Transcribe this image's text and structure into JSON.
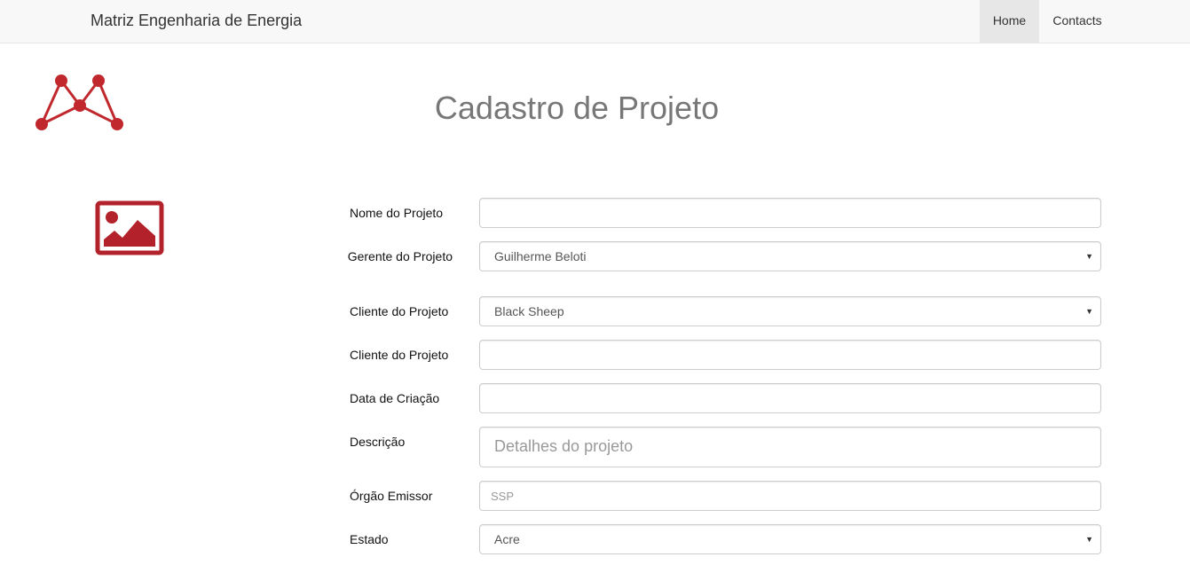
{
  "navbar": {
    "brand": "Matriz Engenharia de Energia",
    "items": [
      {
        "label": "Home",
        "active": true
      },
      {
        "label": "Contacts",
        "active": false
      }
    ]
  },
  "colors": {
    "brand_red": "#c0282d",
    "navbar_bg": "#f8f8f8",
    "active_nav_bg": "#e7e7e7"
  },
  "page": {
    "title": "Cadastro de Projeto"
  },
  "icons": {
    "logo": "matriz-logo-icon",
    "photo": "image-placeholder-icon",
    "caret": "caret-down-icon"
  },
  "form": {
    "nome_projeto": {
      "label": "Nome do Projeto",
      "value": ""
    },
    "gerente_projeto": {
      "label": "Gerente do Projeto",
      "value": "Guilherme Beloti"
    },
    "cliente_projeto_select": {
      "label": "Cliente do Projeto",
      "value": "Black Sheep"
    },
    "cliente_projeto_input": {
      "label": "Cliente do Projeto",
      "value": ""
    },
    "data_criacao": {
      "label": "Data de Criação",
      "value": ""
    },
    "descricao": {
      "label": "Descrição",
      "placeholder": "Detalhes do projeto"
    },
    "orgao_emissor": {
      "label": "Órgão Emissor",
      "placeholder": "SSP"
    },
    "estado": {
      "label": "Estado",
      "value": "Acre"
    }
  }
}
